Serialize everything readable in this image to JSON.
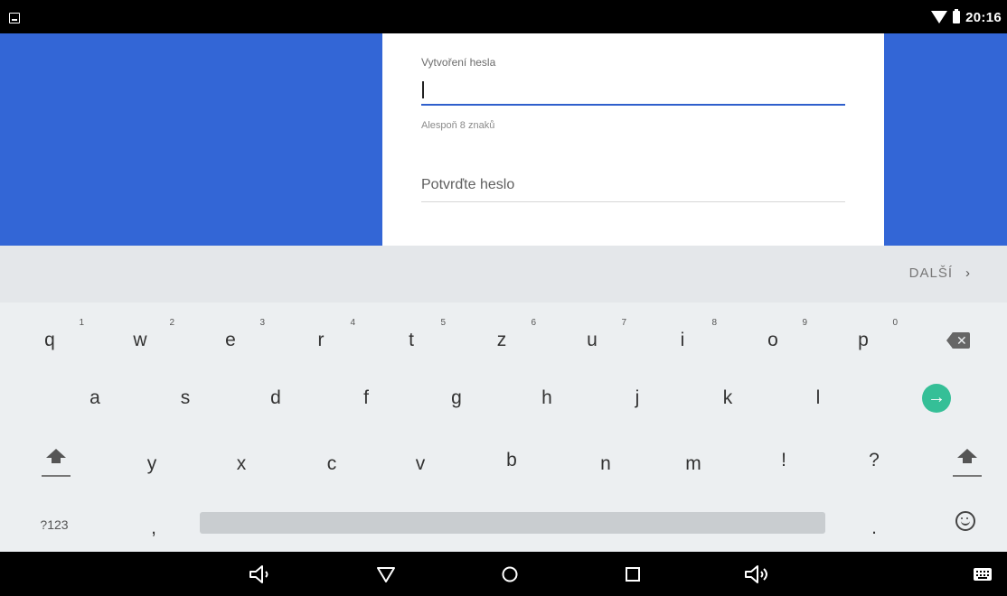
{
  "status_bar": {
    "time": "20:16",
    "left_icon": "image-notification-icon",
    "wifi_icon": "wifi-icon",
    "battery_icon": "battery-icon"
  },
  "form": {
    "password_label": "Vytvoření hesla",
    "password_value": "",
    "password_hint": "Alespoň 8 znaků",
    "confirm_placeholder": "Potvrďte heslo"
  },
  "suggestion_bar": {
    "next_label": "DALŠÍ",
    "next_icon": "chevron-right-icon"
  },
  "keyboard": {
    "row1": [
      {
        "key": "q",
        "hint": "1"
      },
      {
        "key": "w",
        "hint": "2"
      },
      {
        "key": "e",
        "hint": "3"
      },
      {
        "key": "r",
        "hint": "4"
      },
      {
        "key": "t",
        "hint": "5"
      },
      {
        "key": "z",
        "hint": "6"
      },
      {
        "key": "u",
        "hint": "7"
      },
      {
        "key": "i",
        "hint": "8"
      },
      {
        "key": "o",
        "hint": "9"
      },
      {
        "key": "p",
        "hint": "0"
      }
    ],
    "row2": [
      "a",
      "s",
      "d",
      "f",
      "g",
      "h",
      "j",
      "k",
      "l"
    ],
    "row3": [
      "y",
      "x",
      "c",
      "v",
      "b",
      "n",
      "m",
      "!",
      "?"
    ],
    "row4": {
      "symbols": "?123",
      "comma": ",",
      "period": "."
    },
    "icons": {
      "backspace": "backspace-icon",
      "enter": "arrow-right-circle-icon",
      "shift": "shift-icon",
      "emoji": "emoji-icon"
    },
    "enter_color": "#35bf97"
  },
  "nav_bar": {
    "icons": [
      "volume-down-icon",
      "back-icon",
      "home-icon",
      "recents-icon",
      "volume-up-icon",
      "keyboard-icon"
    ]
  },
  "colors": {
    "brand_blue": "#3366d6",
    "input_underline": "#2f5fcc"
  }
}
